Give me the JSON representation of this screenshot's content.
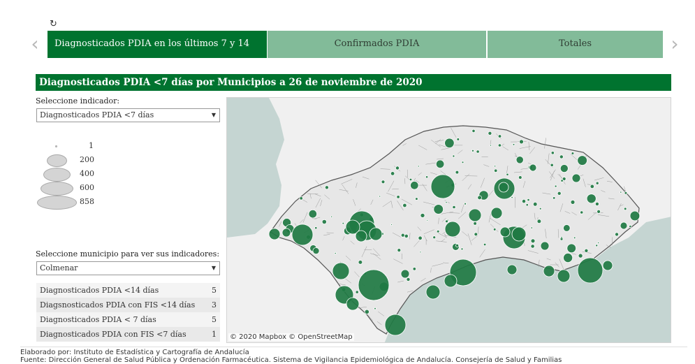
{
  "controls": {
    "refresh_glyph": "↻",
    "prev_glyph": "‹",
    "next_glyph": "›"
  },
  "tabs": [
    {
      "label": "Diagnosticados PDIA en los últimos 7 y 14",
      "active": true
    },
    {
      "label": "Confirmados PDIA",
      "active": false
    },
    {
      "label": "Totales",
      "active": false
    }
  ],
  "title": "Diagnosticados PDIA <7 días por Municipios a 26 de noviembre de 2020",
  "indicator": {
    "label": "Seleccione indicador:",
    "value": "Diagnosticados PDIA <7 días"
  },
  "legend": [
    {
      "value": "1"
    },
    {
      "value": "200"
    },
    {
      "value": "400"
    },
    {
      "value": "600"
    },
    {
      "value": "858"
    }
  ],
  "municipio": {
    "label": "Seleccione municipio para ver sus indicadores:",
    "value": "Colmenar"
  },
  "indicators_table": [
    {
      "name": "Diagnosticados PDIA <14 días",
      "value": "5"
    },
    {
      "name": "Diagsnosticados PDIA con FIS <14 días",
      "value": "3"
    },
    {
      "name": "Diagnosticados PDIA < 7 días",
      "value": "5"
    },
    {
      "name": "Diagnosticados PDIA con FIS <7 días",
      "value": "1"
    }
  ],
  "map": {
    "attribution": "© 2020 Mapbox  © OpenStreetMap",
    "colors": {
      "sea": "#c5d5d2",
      "land": "#f0f0f0",
      "andalucia": "#e7e7e7",
      "bubble": "#1f7a43",
      "bubble_stroke": "#ffffff"
    }
  },
  "footer": {
    "line1": "Elaborado por: Instituto de Estadística y Cartografía de Andalucía",
    "line2": "Fuente: Dirección General de Salud Pública y Ordenación Farmacéutica. Sistema de Vigilancia Epidemiológica de Andalucía. Consejería de Salud y Familias"
  }
}
